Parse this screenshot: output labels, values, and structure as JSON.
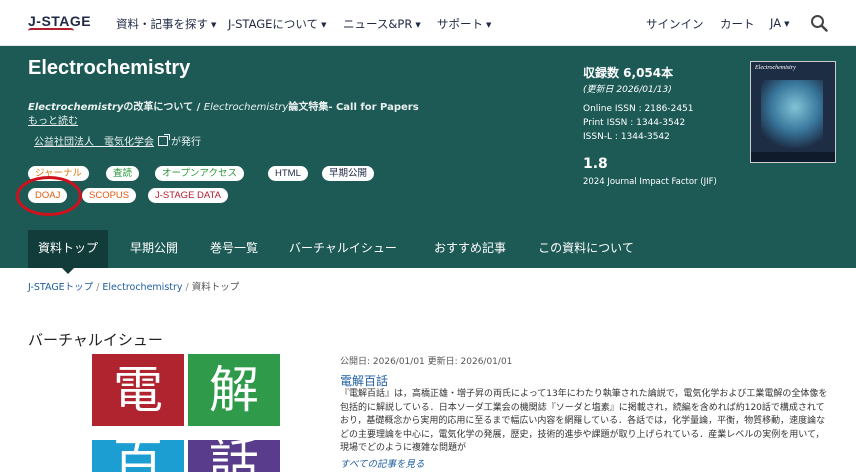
{
  "header": {
    "logo": "J-STAGE",
    "nav": [
      "資料・記事を探す",
      "J-STAGEについて",
      "ニュース&PR",
      "サポート"
    ],
    "signin": "サインイン",
    "cart": "カート",
    "language": "JA"
  },
  "journal": {
    "title": "Electrochemistry",
    "notice_part1": "Electrochemistry",
    "notice_part2": "の改革について / ",
    "notice_part3": "Electrochemistry",
    "notice_part4": "論文特集- Call for Papers",
    "more_link": "もっと読む",
    "publisher": "公益社団法人　電気化学会",
    "publisher_suffix": "が発行",
    "badges": [
      "ジャーナル",
      "査読",
      "オープンアクセス",
      "HTML",
      "早期公開",
      "DOAJ",
      "SCOPUS",
      "J-STAGE DATA"
    ]
  },
  "stats": {
    "count": "収録数 6,054本",
    "updated": "(更新日 2026/01/13)",
    "online_issn": "Online ISSN : 2186-2451",
    "print_issn": "Print ISSN : 1344-3542",
    "issn_l": "ISSN-L : 1344-3542",
    "jif_value": "1.8",
    "jif_label": "2024 Journal Impact Factor (JIF)",
    "cover_title": "Electrochemistry"
  },
  "tabs": [
    "資料トップ",
    "早期公開",
    "巻号一覧",
    "バーチャルイシュー",
    "おすすめ記事",
    "この資料について"
  ],
  "breadcrumb": [
    "J-STAGEトップ",
    "Electrochemistry",
    "資料トップ"
  ],
  "virtual_issue": {
    "section_title": "バーチャルイシュー",
    "tiles": [
      "電",
      "解",
      "百",
      "話"
    ],
    "dates": "公開日: 2026/01/01 更新日: 2026/01/01",
    "article_title": "電解百話",
    "abstract": "『電解百話』は，高橋正雄・増子昇の両氏によって13年にわたり執筆された論説で，電気化学および工業電解の全体像を包括的に解説している．日本ソーダ工業会の機関誌『ソーダと塩素』に掲載され，続編を含めれば約120話で構成されており，基礎概念から実用的応用に至るまで幅広い内容を網羅している．各話では，化学量論，平衡，物質移動，速度論などの主要理論を中心に，電気化学の発展，歴史，技術的進歩や課題が取り上げられている．産業レベルの実例を用いて，現場でどのように複雑な問題が",
    "see_all": "すべての記事を見る"
  },
  "colors": {
    "hero": "#1d5a56",
    "tab_active": "#123c39",
    "link": "#1f5fa0",
    "highlight": "#d0101c"
  }
}
